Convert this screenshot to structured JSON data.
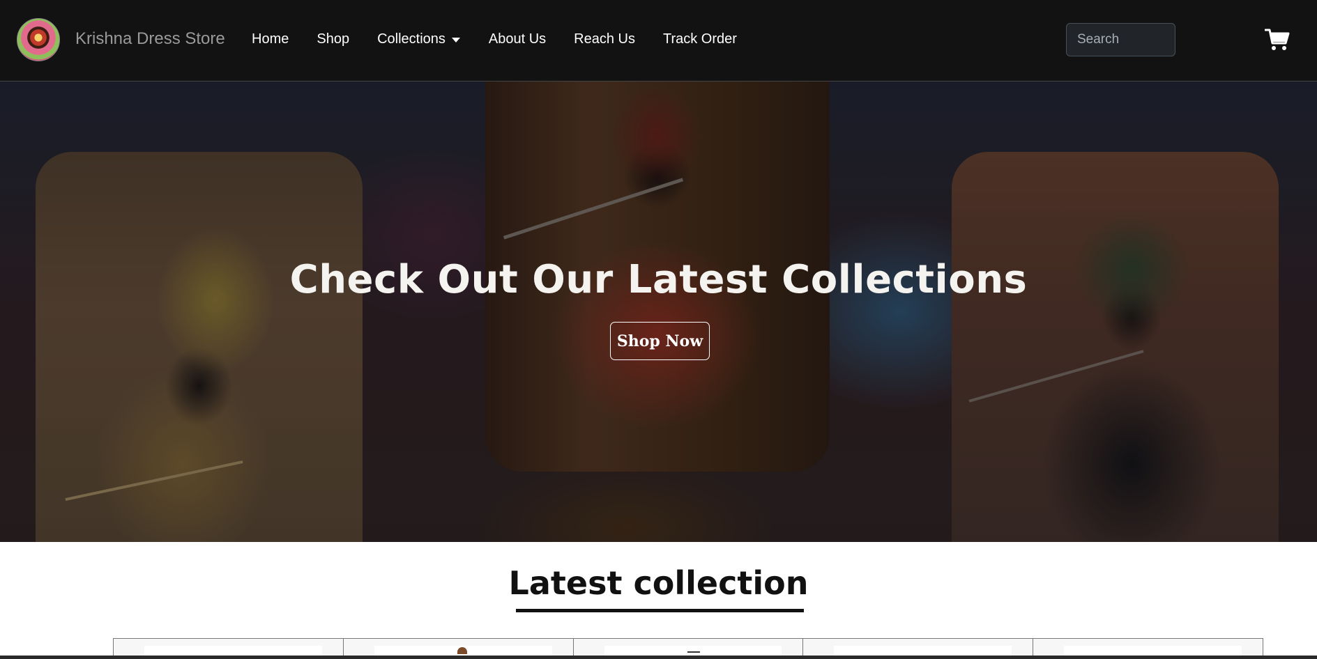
{
  "navbar": {
    "brand": "Krishna Dress Store",
    "links": {
      "home": "Home",
      "shop": "Shop",
      "collections": "Collections",
      "about": "About Us",
      "reach": "Reach Us",
      "track": "Track Order"
    },
    "search_placeholder": "Search",
    "cart_icon": "cart-icon"
  },
  "hero": {
    "title": "Check Out Our Latest Collections",
    "button": "Shop Now"
  },
  "latest": {
    "title": "Latest collection"
  },
  "colors": {
    "navbar_bg": "#121212",
    "text_light": "#ffffff",
    "section_bg": "#ffffff"
  }
}
